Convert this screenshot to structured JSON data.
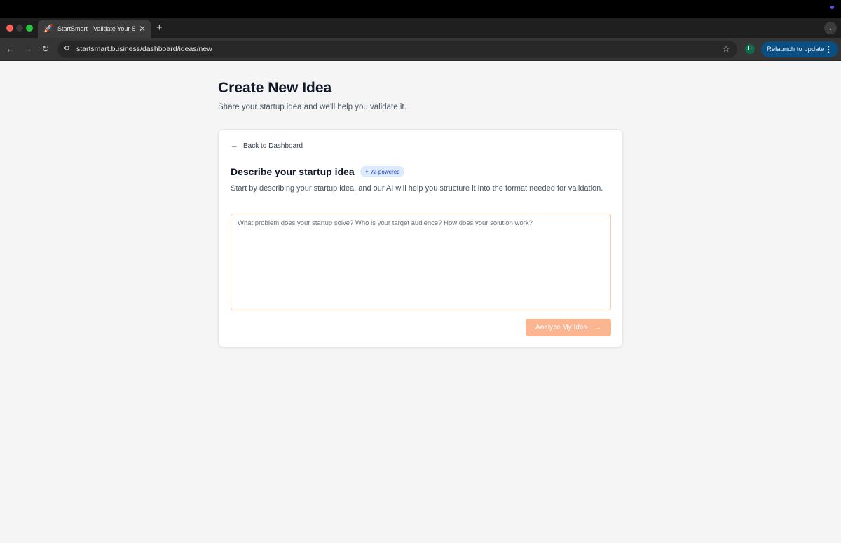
{
  "browser": {
    "tab_title": "StartSmart - Validate Your St",
    "tab_close": "✕",
    "new_tab": "+",
    "url": "startsmart.business/dashboard/ideas/new",
    "profile_initial": "H",
    "relaunch_label": "Relaunch to update",
    "icons": [
      "back-icon",
      "forward-icon",
      "reload-icon",
      "site-info-icon",
      "star-icon",
      "rocket-icon",
      "more-icon",
      "chevron-down-icon"
    ]
  },
  "page": {
    "title": "Create New Idea",
    "subtitle": "Share your startup idea and we'll help you validate it."
  },
  "card": {
    "back_label": "Back to Dashboard",
    "section_title": "Describe your startup idea",
    "badge_label": "AI-powered",
    "description": "Start by describing your startup idea, and our AI will help you structure it into the format needed for validation.",
    "textarea_placeholder": "What problem does your startup solve? Who is your target audience? How does your solution work?",
    "textarea_value": "",
    "submit_label": "Analyze My Idea",
    "submit_enabled": false
  },
  "colors": {
    "accent": "#fbb591",
    "badge_bg": "#dbeafe",
    "badge_text": "#1e40af",
    "textarea_border": "#f6c9a9"
  }
}
